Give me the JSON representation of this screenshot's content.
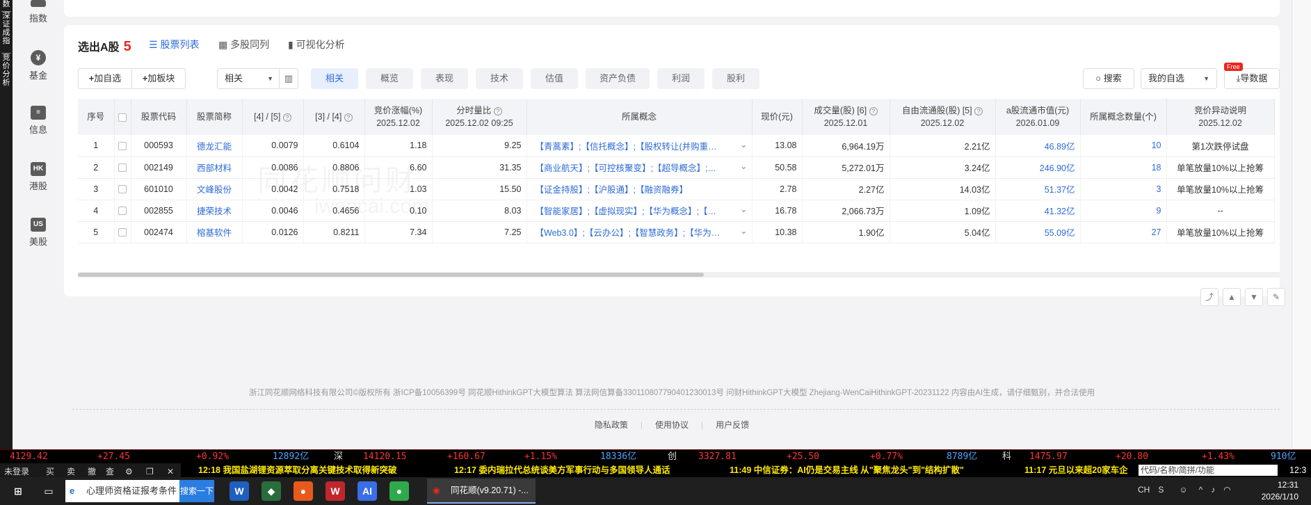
{
  "left_edge": {
    "top": "数",
    "mid": "深证成指",
    "bot": "竞价分析"
  },
  "sidebar": [
    {
      "label": "指数",
      "icon": "☰"
    },
    {
      "label": "基金",
      "icon": "¥"
    },
    {
      "label": "信息",
      "icon": "≡"
    },
    {
      "label": "港股",
      "icon": "HK"
    },
    {
      "label": "美股",
      "icon": "US"
    }
  ],
  "header": {
    "title": "选出A股",
    "count": "5",
    "tabs": [
      "股票列表",
      "多股同列",
      "可视化分析"
    ]
  },
  "toolbar": {
    "add_watch": "加自选",
    "add_block": "加板块",
    "select_value": "相关",
    "search": "搜索",
    "mywatch": "我的自选",
    "export": "导数据",
    "free_badge": "Free"
  },
  "pills": [
    "相关",
    "概览",
    "表现",
    "技术",
    "估值",
    "资产负债",
    "利润",
    "股利"
  ],
  "table": {
    "headers": [
      [
        "序号",
        ""
      ],
      [
        "",
        ""
      ],
      [
        "股票代码",
        ""
      ],
      [
        "股票简称",
        ""
      ],
      [
        "[4] / [5]",
        ""
      ],
      [
        "[3] / [4]",
        ""
      ],
      [
        "竞价涨幅(%)",
        "2025.12.02"
      ],
      [
        "分时量比",
        "2025.12.02 09:25"
      ],
      [
        "所属概念",
        ""
      ],
      [
        "现价(元)",
        ""
      ],
      [
        "成交量(股) [6]",
        "2025.12.01"
      ],
      [
        "自由流通股(股) [5]",
        "2025.12.02"
      ],
      [
        "a股流通市值(元)",
        "2026.01.09"
      ],
      [
        "所属概念数量(个)",
        ""
      ],
      [
        "竞价异动说明",
        "2025.12.02"
      ]
    ],
    "rows": [
      {
        "no": "1",
        "code": "000593",
        "name": "德龙汇能",
        "r45": "0.0079",
        "r34": "0.6104",
        "chg": "1.18",
        "vr": "9.25",
        "concept": "【青蒿素】;【信托概念】;【股权转让(并购重…",
        "price": "13.08",
        "vol": "6,964.19万",
        "free": "2.21亿",
        "mktcap": "46.89亿",
        "ncon": "10",
        "note": "第1次跌停试盘"
      },
      {
        "no": "2",
        "code": "002149",
        "name": "西部材料",
        "r45": "0.0086",
        "r34": "0.8806",
        "chg": "6.60",
        "vr": "31.35",
        "concept": "【商业航天】;【可控核聚变】;【超导概念】;…",
        "price": "50.58",
        "vol": "5,272.01万",
        "free": "3.24亿",
        "mktcap": "246.90亿",
        "ncon": "18",
        "note": "单笔放量10%以上抢筹"
      },
      {
        "no": "3",
        "code": "601010",
        "name": "文峰股份",
        "r45": "0.0042",
        "r34": "0.7518",
        "chg": "1.03",
        "vr": "15.50",
        "concept": "【证金持股】;【沪股通】;【融资融券】",
        "price": "2.78",
        "vol": "2.27亿",
        "free": "14.03亿",
        "mktcap": "51.37亿",
        "ncon": "3",
        "note": "单笔放量10%以上抢筹"
      },
      {
        "no": "4",
        "code": "002855",
        "name": "捷荣技术",
        "r45": "0.0046",
        "r34": "0.4656",
        "chg": "0.10",
        "vr": "8.03",
        "concept": "【智能家居】;【虚拟现实】;【华为概念】;【…",
        "price": "16.78",
        "vol": "2,066.73万",
        "free": "1.09亿",
        "mktcap": "41.32亿",
        "ncon": "9",
        "note": "--"
      },
      {
        "no": "5",
        "code": "002474",
        "name": "榕基软件",
        "r45": "0.0126",
        "r34": "0.8211",
        "chg": "7.34",
        "vr": "7.25",
        "concept": "【Web3.0】;【云办公】;【智慧政务】;【华为…",
        "price": "10.38",
        "vol": "1.90亿",
        "free": "5.04亿",
        "mktcap": "55.09亿",
        "ncon": "27",
        "note": "单笔放量10%以上抢筹"
      }
    ]
  },
  "watermark": "同花顺问财",
  "watermark2": "iwencai.com",
  "footer": {
    "text": "浙江同花顺网络科技有限公司©版权所有 浙ICP备10056399号 同花顺HithinkGPT大模型算法 算法网信算备330110807790401230013号 问财HithinkGPT大模型 Zhejiang-WenCaiHithinkGPT-20231122 内容由AI生成，请仔细甄别，并合法使用",
    "links": [
      "隐私政策",
      "使用协议",
      "用户反馈"
    ]
  },
  "ticker_indices": [
    {
      "t": "4129.42",
      "c": "#ff3333"
    },
    {
      "t": "+27.45",
      "c": "#ff3333"
    },
    {
      "t": "+0.92%",
      "c": "#ff3333"
    },
    {
      "t": "12892亿",
      "c": "#4da6ff"
    },
    {
      "t": "深",
      "c": "#dddddd"
    },
    {
      "t": "14120.15",
      "c": "#ff3333"
    },
    {
      "t": "+160.67",
      "c": "#ff3333"
    },
    {
      "t": "+1.15%",
      "c": "#ff3333"
    },
    {
      "t": "18336亿",
      "c": "#4da6ff"
    },
    {
      "t": "创",
      "c": "#dddddd"
    },
    {
      "t": "3327.81",
      "c": "#ff3333"
    },
    {
      "t": "+25.50",
      "c": "#ff3333"
    },
    {
      "t": "+0.77%",
      "c": "#ff3333"
    },
    {
      "t": "8789亿",
      "c": "#4da6ff"
    },
    {
      "t": "科",
      "c": "#dddddd"
    },
    {
      "t": "1475.97",
      "c": "#ff3333"
    },
    {
      "t": "+20.80",
      "c": "#ff3333"
    },
    {
      "t": "+1.43%",
      "c": "#ff3333"
    },
    {
      "t": "910亿",
      "c": "#4da6ff"
    }
  ],
  "mini_bar": [
    "未登录",
    "买",
    "卖",
    "撤",
    "查",
    "⚙",
    "❐",
    "✕"
  ],
  "news": [
    "12:18 我国盐湖锂资源萃取分离关键技术取得新突破",
    "12:17 委内瑞拉代总统谈美方军事行动与多国领导人通话",
    "11:49 中信证券：AI仍是交易主线 从\"聚焦龙头\"到\"结构扩散\"",
    "11:17 元旦以来超20家车企"
  ],
  "code_input": "代码/名称/简拼/功能",
  "taskbar": {
    "search_text": "心理师资格证报考条件",
    "search_btn": "搜索一下",
    "app_label": "同花顺(v9.20.71) -...",
    "lang": "CH",
    "time": "12:31",
    "date": "2026/1/10",
    "edge": "12:3"
  }
}
